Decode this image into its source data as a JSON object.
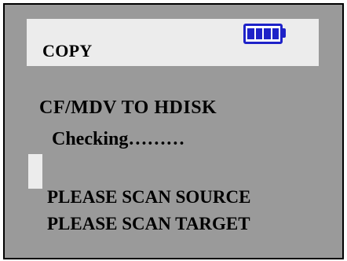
{
  "header": {
    "title": "COPY",
    "battery": {
      "icon": "battery-icon",
      "level": 1.0,
      "cells": 4,
      "color": "#1e22c8"
    }
  },
  "main": {
    "mode": "CF/MDV TO  HDISK",
    "status": "Checking………",
    "progress": 0.04,
    "prompts": [
      "PLEASE SCAN SOURCE",
      "PLEASE SCAN TARGET"
    ]
  },
  "colors": {
    "screen_background": "#9a9a9a",
    "header_background": "#ececec",
    "text": "#000000"
  }
}
